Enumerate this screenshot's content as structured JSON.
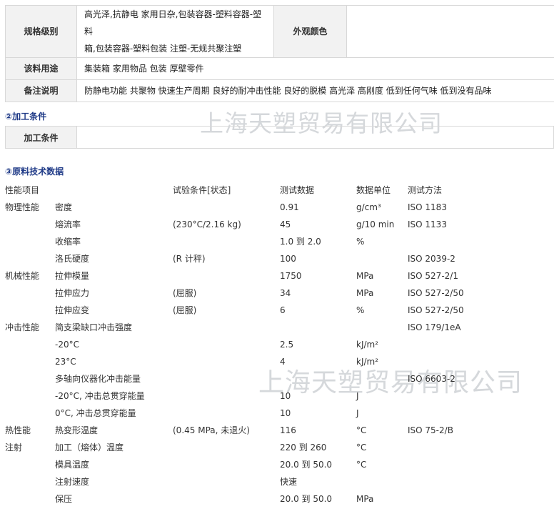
{
  "spec": {
    "rows": [
      {
        "label": "规格级别",
        "value_lines": [
          "高光泽,抗静电 家用日杂,包装容器-塑料容器-塑料",
          "箱,包装容器-塑料包装 注塑-无规共聚注塑"
        ],
        "extra_label": "外观颜色",
        "extra_value": ""
      },
      {
        "label": "该料用途",
        "value": "集装箱 家用物品 包装 厚壁零件"
      },
      {
        "label": "备注说明",
        "value": "防静电功能 共聚物 快速生产周期 良好的耐冲击性能 良好的脱模 高光泽 高刚度 低到任何气味 低到没有品味"
      }
    ]
  },
  "processing": {
    "title": "②加工条件",
    "label": "加工条件",
    "value": ""
  },
  "technical": {
    "title": "③原料技术数据",
    "headers": {
      "category": "性能项目",
      "property": "",
      "condition": "试验条件[状态]",
      "value": "测试数据",
      "unit": "数据单位",
      "method": "测试方法"
    },
    "rows": [
      {
        "category": "物理性能",
        "property": "密度",
        "condition": "",
        "value": "0.91",
        "unit": "g/cm³",
        "method": "ISO 1183"
      },
      {
        "category": "",
        "property": "熔流率",
        "condition": " (230°C/2.16 kg)",
        "value": "45",
        "unit": "g/10 min",
        "method": "ISO 1133"
      },
      {
        "category": "",
        "property": "收缩率",
        "condition": "",
        "value": "1.0 到 2.0",
        "unit": "%",
        "method": ""
      },
      {
        "category": "",
        "property": "洛氏硬度",
        "condition": "(R 计秤)",
        "value": "100",
        "unit": "",
        "method": "ISO 2039-2"
      },
      {
        "category": "机械性能",
        "property": "拉伸模量",
        "condition": "",
        "value": "1750",
        "unit": "MPa",
        "method": "ISO 527-2/1"
      },
      {
        "category": "",
        "property": "拉伸应力",
        "condition": "(屈服)",
        "value": "34",
        "unit": "MPa",
        "method": "ISO 527-2/50"
      },
      {
        "category": "",
        "property": "拉伸应变",
        "condition": "(屈服)",
        "value": "6",
        "unit": "%",
        "method": "ISO 527-2/50"
      },
      {
        "category": "冲击性能",
        "property": "简支梁缺口冲击强度",
        "condition": "",
        "value": "",
        "unit": "",
        "method": "ISO 179/1eA"
      },
      {
        "category": "",
        "property": "-20°C",
        "condition": "",
        "value": "2.5",
        "unit": "kJ/m²",
        "method": ""
      },
      {
        "category": "",
        "property": "23°C",
        "condition": "",
        "value": "4",
        "unit": "kJ/m²",
        "method": ""
      },
      {
        "category": "",
        "property": "多轴向仪器化冲击能量",
        "condition": "",
        "value": "",
        "unit": "",
        "method": "ISO 6603-2"
      },
      {
        "category": "",
        "property": "-20°C, 冲击总贯穿能量",
        "condition": "",
        "value": "10",
        "unit": "J",
        "method": ""
      },
      {
        "category": "",
        "property": "0°C, 冲击总贯穿能量",
        "condition": "",
        "value": "10",
        "unit": "J",
        "method": ""
      },
      {
        "category": "热性能",
        "property": "热变形温度",
        "condition": "(0.45 MPa, 未退火)",
        "value": "116",
        "unit": "°C",
        "method": "ISO 75-2/B"
      },
      {
        "category": "注射",
        "property": "加工（熔体）温度",
        "condition": "",
        "value": "220 到 260",
        "unit": "°C",
        "method": ""
      },
      {
        "category": "",
        "property": "模具温度",
        "condition": "",
        "value": "20.0 到 50.0",
        "unit": "°C",
        "method": ""
      },
      {
        "category": "",
        "property": "注射速度",
        "condition": "",
        "value": "快速",
        "unit": "",
        "method": ""
      },
      {
        "category": "",
        "property": "保压",
        "condition": "",
        "value": "20.0 到 50.0",
        "unit": "MPa",
        "method": ""
      }
    ]
  },
  "watermarks": [
    "上海天塑贸易有限公司",
    "上海天塑贸易有限公司"
  ],
  "colors": {
    "label_bg": "#f2f2f2",
    "border": "#d8d8d8",
    "section_title": "#1f3a87",
    "watermark": "#c8cbd0"
  }
}
